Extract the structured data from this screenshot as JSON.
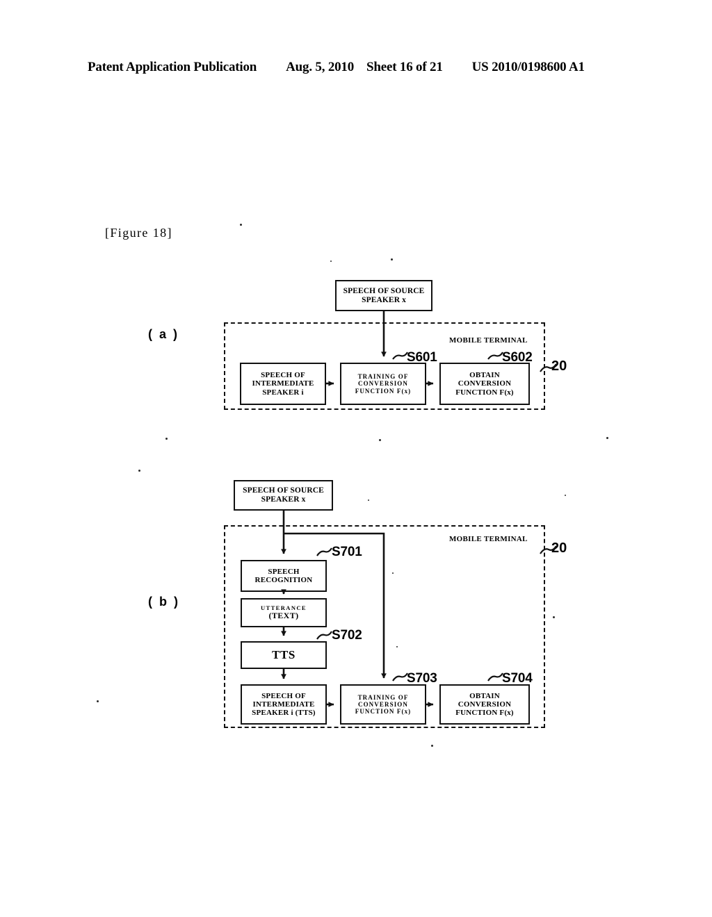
{
  "header": {
    "publication": "Patent Application Publication",
    "date": "Aug. 5, 2010",
    "sheet": "Sheet 16 of 21",
    "document_number": "US 2010/0198600 A1"
  },
  "figure": {
    "label": "[Figure  18]"
  },
  "panels": [
    {
      "letter": "( a )",
      "container_label": "MOBILE TERMINAL",
      "container_ref": "20",
      "boxes": {
        "source_speech": {
          "line1": "SPEECH OF SOURCE",
          "line2": "SPEAKER x"
        },
        "intermediate_speech": {
          "line1": "SPEECH OF",
          "line2": "INTERMEDIATE",
          "line3": "SPEAKER i"
        },
        "training": {
          "line1": "TRAINING  OF",
          "line2": "CONVERSION",
          "line3": "FUNCTION  F(x)"
        },
        "obtain": {
          "line1": "OBTAIN",
          "line2": "CONVERSION",
          "line3": "FUNCTION F(x)"
        }
      },
      "steps": {
        "training": "S601",
        "obtain": "S602"
      }
    },
    {
      "letter": "( b )",
      "container_label": "MOBILE TERMINAL",
      "container_ref": "20",
      "boxes": {
        "source_speech": {
          "line1": "SPEECH OF SOURCE",
          "line2": "SPEAKER x"
        },
        "speech_recognition": {
          "line1": "SPEECH",
          "line2": "RECOGNITION"
        },
        "utterance": {
          "line1": "UTTERANCE",
          "line2": "(TEXT)"
        },
        "tts": {
          "line1": "TTS"
        },
        "intermediate_speech": {
          "line1": "SPEECH OF",
          "line2": "INTERMEDIATE",
          "line3": "SPEAKER i (TTS)"
        },
        "training": {
          "line1": "TRAINING  OF",
          "line2": "CONVERSION",
          "line3": "FUNCTION  F(x)"
        },
        "obtain": {
          "line1": "OBTAIN",
          "line2": "CONVERSION",
          "line3": "FUNCTION F(x)"
        }
      },
      "steps": {
        "speech_recognition": "S701",
        "tts": "S702",
        "training": "S703",
        "obtain": "S704"
      }
    }
  ],
  "colors": {
    "ink": "#111111",
    "paper": "#ffffff"
  }
}
